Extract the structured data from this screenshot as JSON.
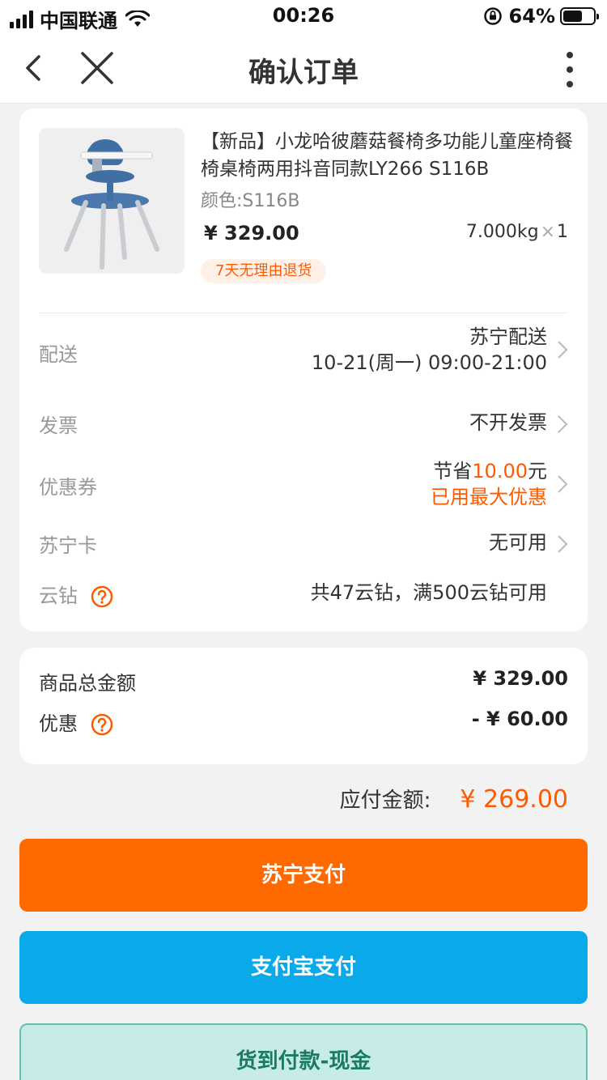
{
  "status_bar": {
    "carrier": "中国联通",
    "time": "00:26",
    "battery": "64%",
    "battery_level": 0.64
  },
  "nav": {
    "title": "确认订单",
    "back_icon": "chevron-left-icon",
    "close_icon": "close-icon",
    "more_icon": "more-vertical-icon"
  },
  "product": {
    "title": "【新品】小龙哈彼蘑菇餐椅多功能儿童座椅餐椅桌椅两用抖音同款LY266 S116B",
    "color": "颜色:S116B",
    "price": "¥ 329.00",
    "weight": "7.000kg",
    "qty_symbol": "×",
    "qty": "1",
    "return_tag": "7天无理由退货"
  },
  "rows": {
    "delivery": {
      "label": "配送",
      "line1": "苏宁配送",
      "line2": "10-21(周一) 09:00-21:00"
    },
    "invoice": {
      "label": "发票",
      "value": "不开发票"
    },
    "coupon": {
      "label": "优惠券",
      "prefix": "节省",
      "amount": "10.00",
      "suffix": "元",
      "note": "已用最大优惠"
    },
    "suning_card": {
      "label": "苏宁卡",
      "value": "无可用"
    },
    "cloud_diamond": {
      "label": "云钻",
      "value": "共47云钻，满500云钻可用"
    }
  },
  "summary": {
    "total_label": "商品总金额",
    "total_value": "¥ 329.00",
    "discount_label": "优惠",
    "discount_value": "- ¥ 60.00"
  },
  "payable": {
    "label": "应付金额:",
    "amount": "¥ 269.00"
  },
  "buttons": {
    "suning_pay": "苏宁支付",
    "alipay": "支付宝支付",
    "cod": "货到付款-现金"
  },
  "colors": {
    "accent": "#ff6a00",
    "alipay": "#0aa9ea",
    "cod": "#c7ece7"
  }
}
